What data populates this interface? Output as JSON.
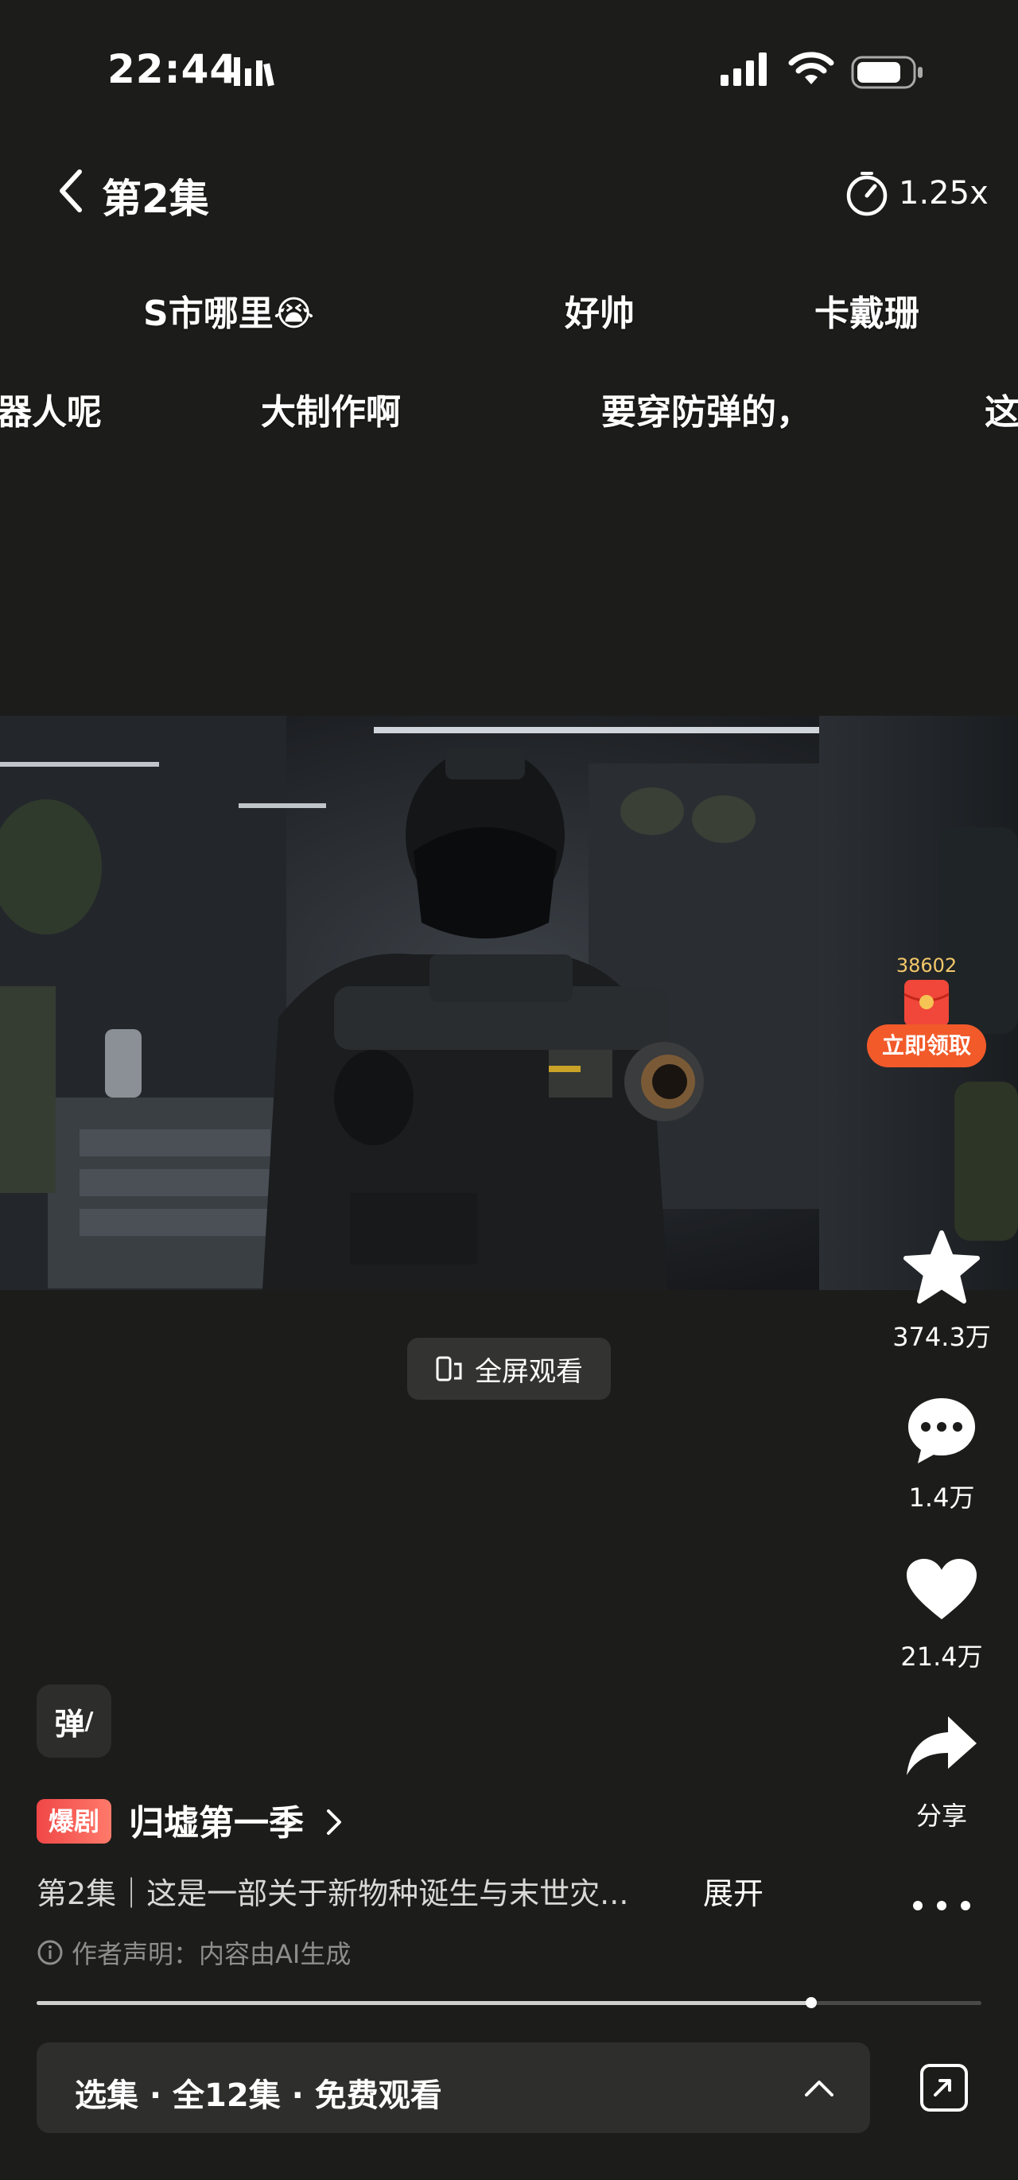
{
  "status_bar": {
    "time": "22:44"
  },
  "header": {
    "title": "第2集",
    "speed": "1.25x"
  },
  "danmaku": [
    "S市哪里😭",
    "好帅",
    "卡戴珊",
    "器人呢",
    "大制作啊",
    "要穿防弹的，",
    "这"
  ],
  "red_packet": {
    "count": "38602",
    "button": "立即领取"
  },
  "fullscreen": {
    "label": "全屏观看"
  },
  "actions": {
    "favorite": "374.3万",
    "comment": "1.4万",
    "like": "21.4万",
    "share": "分享"
  },
  "bottom": {
    "danmaku_button": "弹",
    "badge": "爆剧",
    "series_title": "归墟第一季",
    "description": "第2集｜这是一部关于新物种诞生与末世灾...",
    "expand": "展开",
    "ai_notice": "作者声明：内容由AI生成",
    "progress": 0.82,
    "episodes_label": "选集 · 全12集 · 免费观看"
  },
  "colors": {
    "background": "#1c1c1a",
    "accent": "#f25a2a",
    "badge": "#f04747"
  },
  "icons": [
    "back-chevron-icon",
    "speed-timer-icon",
    "star-icon",
    "comment-icon",
    "heart-icon",
    "share-icon",
    "more-icon",
    "info-icon",
    "chevron-up-icon",
    "pip-icon",
    "phone-rotate-icon"
  ]
}
